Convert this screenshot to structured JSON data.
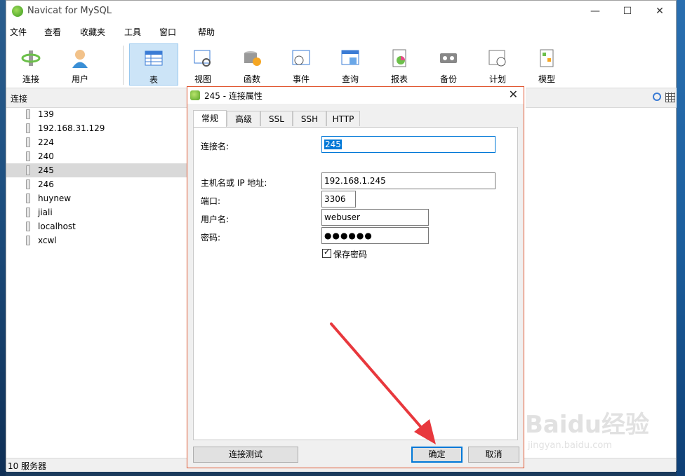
{
  "app": {
    "title": "Navicat for MySQL"
  },
  "window_controls": {
    "minimize": "—",
    "maximize": "☐",
    "close": "✕"
  },
  "menu": [
    "文件",
    "查看",
    "收藏夹",
    "工具",
    "窗口",
    "帮助"
  ],
  "toolbar": [
    {
      "label": "连接",
      "icon": "connection-icon"
    },
    {
      "label": "用户",
      "icon": "user-icon"
    },
    {
      "label": "表",
      "icon": "table-icon",
      "active": true
    },
    {
      "label": "视图",
      "icon": "view-icon"
    },
    {
      "label": "函数",
      "icon": "function-icon"
    },
    {
      "label": "事件",
      "icon": "event-icon"
    },
    {
      "label": "查询",
      "icon": "query-icon"
    },
    {
      "label": "报表",
      "icon": "report-icon"
    },
    {
      "label": "备份",
      "icon": "backup-icon"
    },
    {
      "label": "计划",
      "icon": "schedule-icon"
    },
    {
      "label": "模型",
      "icon": "model-icon"
    }
  ],
  "connections": {
    "header": "连接",
    "items": [
      "139",
      "192.168.31.129",
      "224",
      "240",
      "245",
      "246",
      "huynew",
      "jiali",
      "localhost",
      "xcwl"
    ],
    "selected": "245"
  },
  "status": {
    "text": "10 服务器"
  },
  "dialog": {
    "title": "245 - 连接属性",
    "tabs": [
      "常规",
      "高级",
      "SSL",
      "SSH",
      "HTTP"
    ],
    "active_tab": "常规",
    "fields": {
      "conn_name_label": "连接名:",
      "conn_name_value": "245",
      "host_label": "主机名或 IP 地址:",
      "host_value": "192.168.1.245",
      "port_label": "端口:",
      "port_value": "3306",
      "user_label": "用户名:",
      "user_value": "webuser",
      "password_label": "密码:",
      "password_value": "●●●●●●",
      "save_password_label": "保存密码",
      "save_password_checked": true
    },
    "buttons": {
      "test": "连接测试",
      "ok": "确定",
      "cancel": "取消"
    }
  },
  "watermark": {
    "main": "Baidu经验",
    "sub": "jingyan.baidu.com"
  },
  "colors": {
    "accent": "#0078d7",
    "annotation_arrow": "#e8383d",
    "selected_row": "#d9d9d9",
    "active_tool": "#cce4f7"
  }
}
